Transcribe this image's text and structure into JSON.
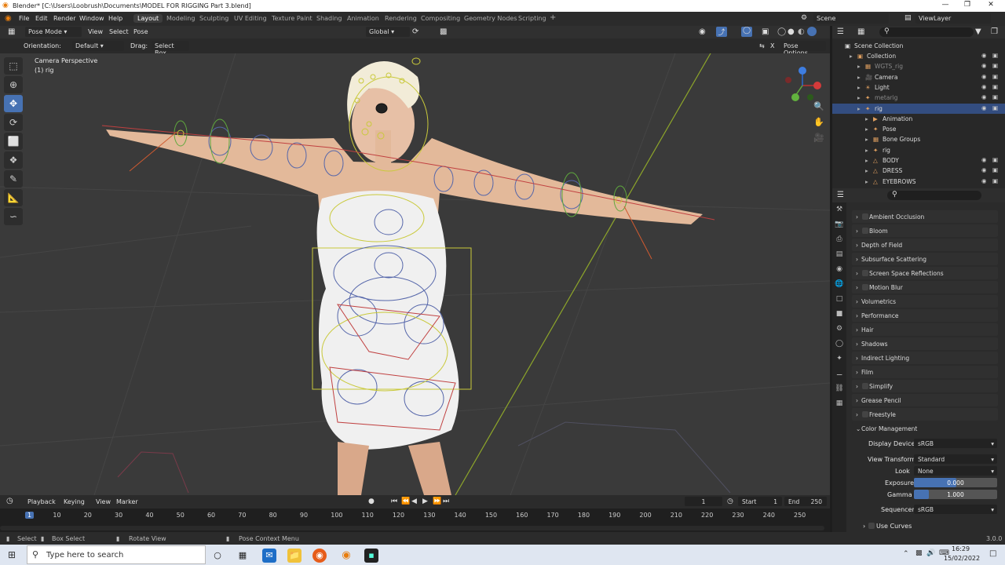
{
  "window": {
    "title": "Blender* [C:\\Users\\Loobrush\\Documents\\MODEL FOR RIGGING Part 3.blend]"
  },
  "menu": [
    "File",
    "Edit",
    "Render",
    "Window",
    "Help"
  ],
  "workspaces": [
    "Layout",
    "Modeling",
    "Sculpting",
    "UV Editing",
    "Texture Paint",
    "Shading",
    "Animation",
    "Rendering",
    "Compositing",
    "Geometry Nodes",
    "Scripting",
    "+"
  ],
  "scene": {
    "name": "Scene",
    "view_layer": "ViewLayer"
  },
  "viewport_header": {
    "mode": "Pose Mode",
    "menus": [
      "View",
      "Select",
      "Pose"
    ],
    "transform": "Global"
  },
  "tool_options": {
    "orientation_label": "Orientation:",
    "orientation": "Default",
    "drag_label": "Drag:",
    "drag": "Select Box",
    "pose_options": "Pose Options",
    "x_label": "X"
  },
  "viewport": {
    "view_name": "Camera Perspective",
    "object": "(1) rig"
  },
  "outliner": {
    "root": "Scene Collection",
    "rows": [
      {
        "label": "Collection",
        "indent": 1
      },
      {
        "label": "WGTS_rig",
        "indent": 2
      },
      {
        "label": "Camera",
        "indent": 2
      },
      {
        "label": "Light",
        "indent": 2
      },
      {
        "label": "metarig",
        "indent": 2
      },
      {
        "label": "rig",
        "indent": 2
      },
      {
        "label": "Animation",
        "indent": 3
      },
      {
        "label": "Pose",
        "indent": 3
      },
      {
        "label": "Bone Groups",
        "indent": 3
      },
      {
        "label": "rig",
        "indent": 3
      },
      {
        "label": "BODY",
        "indent": 3
      },
      {
        "label": "DRESS",
        "indent": 3
      },
      {
        "label": "EYEBROWS",
        "indent": 3
      }
    ]
  },
  "properties": {
    "panels": [
      "Ambient Occlusion",
      "Bloom",
      "Depth of Field",
      "Subsurface Scattering",
      "Screen Space Reflections",
      "Motion Blur",
      "Volumetrics",
      "Performance",
      "Hair",
      "Shadows",
      "Indirect Lighting",
      "Film",
      "Simplify",
      "Grease Pencil",
      "Freestyle",
      "Color Management"
    ],
    "color_management": {
      "display_device_label": "Display Device",
      "display_device": "sRGB",
      "view_transform_label": "View Transform",
      "view_transform": "Standard",
      "look_label": "Look",
      "look": "None",
      "exposure_label": "Exposure",
      "exposure": "0.000",
      "gamma_label": "Gamma",
      "gamma": "1.000",
      "sequencer_label": "Sequencer",
      "sequencer": "sRGB",
      "use_curves": "Use Curves"
    }
  },
  "timeline": {
    "menus": [
      "Playback",
      "Keying",
      "View",
      "Marker"
    ],
    "current_frame": "1",
    "start_label": "Start",
    "start": "1",
    "end_label": "End",
    "end": "250",
    "ticks": [
      "1",
      "10",
      "20",
      "30",
      "40",
      "50",
      "60",
      "70",
      "80",
      "90",
      "100",
      "110",
      "120",
      "130",
      "140",
      "150",
      "160",
      "170",
      "180",
      "190",
      "200",
      "210",
      "220",
      "230",
      "240",
      "250"
    ]
  },
  "statusbar": {
    "items": [
      "Select",
      "Box Select",
      "Rotate View",
      "Pose Context Menu"
    ],
    "version": "3.0.0"
  },
  "taskbar": {
    "search_placeholder": "Type here to search",
    "time": "16:29",
    "date": "15/02/2022"
  }
}
